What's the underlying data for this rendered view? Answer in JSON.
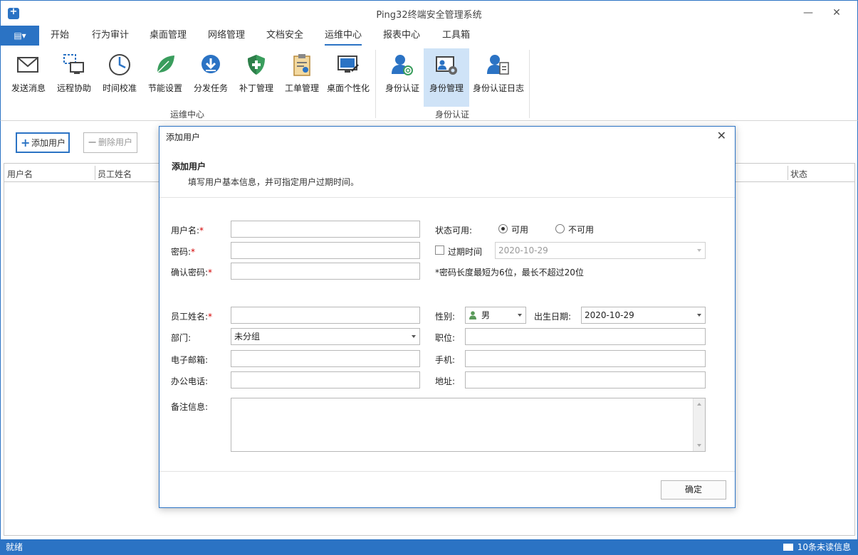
{
  "window": {
    "title": "Ping32终端安全管理系统",
    "minimize_glyph": "—",
    "close_glyph": "✕"
  },
  "menu": {
    "button_glyph": "▤▾",
    "tabs": [
      "开始",
      "行为审计",
      "桌面管理",
      "网络管理",
      "文档安全",
      "运维中心",
      "报表中心",
      "工具箱"
    ],
    "active_tab": "运维中心"
  },
  "ribbon": {
    "groups": [
      {
        "label": "运维中心"
      },
      {
        "label": "身份认证"
      }
    ],
    "buttons": [
      {
        "label": "发送消息",
        "icon": "envelope-icon"
      },
      {
        "label": "远程协助",
        "icon": "remote-desktop-icon"
      },
      {
        "label": "时间校准",
        "icon": "clock-icon"
      },
      {
        "label": "节能设置",
        "icon": "leaf-icon"
      },
      {
        "label": "分发任务",
        "icon": "download-circle-icon"
      },
      {
        "label": "补丁管理",
        "icon": "shield-icon"
      },
      {
        "label": "工单管理",
        "icon": "clipboard-icon"
      },
      {
        "label": "桌面个性化",
        "icon": "monitor-brush-icon"
      },
      {
        "label": "身份认证",
        "icon": "user-fingerprint-icon"
      },
      {
        "label": "身份管理",
        "icon": "id-card-gear-icon"
      },
      {
        "label": "身份认证日志",
        "icon": "user-log-icon"
      }
    ],
    "selected_button": "身份管理"
  },
  "toolbar": {
    "add_user": "添加用户",
    "delete_user": "删除用户"
  },
  "grid": {
    "columns": [
      "用户名",
      "员工姓名",
      "状态"
    ]
  },
  "status": {
    "left": "就绪",
    "right": "10条未读信息"
  },
  "dialog": {
    "title": "添加用户",
    "close_glyph": "✕",
    "heading": "添加用户",
    "subheading": "填写用户基本信息，并可指定用户过期时间。",
    "required_mark": "*",
    "fields": {
      "username_label": "用户名:",
      "password_label": "密码:",
      "confirm_label": "确认密码:",
      "status_label": "状态可用:",
      "status_options": [
        "可用",
        "不可用"
      ],
      "status_selected": "可用",
      "expire_label": "过期时间",
      "expire_value": "2020-10-29",
      "password_hint": "*密码长度最短为6位，最长不超过20位",
      "employee_label": "员工姓名:",
      "gender_label": "性别:",
      "gender_value": "男",
      "birth_label": "出生日期:",
      "birth_value": "2020-10-29",
      "dept_label": "部门:",
      "dept_value": "未分组",
      "position_label": "职位:",
      "email_label": "电子邮箱:",
      "mobile_label": "手机:",
      "office_phone_label": "办公电话:",
      "address_label": "地址:",
      "remarks_label": "备注信息:"
    },
    "ok_button": "确定"
  },
  "colors": {
    "accent": "#2b73c4",
    "selected": "#cfe3f7",
    "required": "#d40000"
  }
}
